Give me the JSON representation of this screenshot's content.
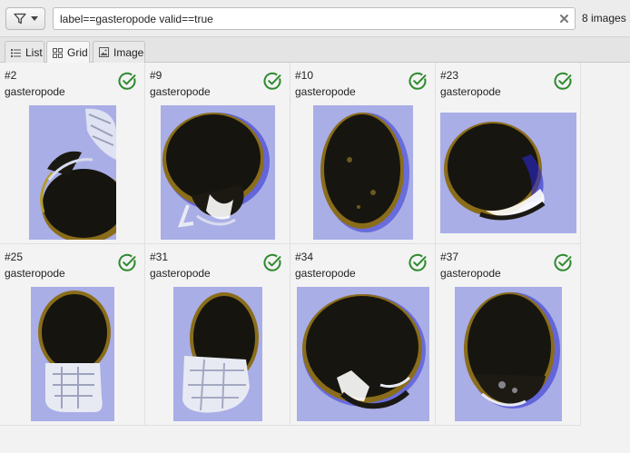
{
  "toolbar": {
    "filter_icon": "filter-icon",
    "search_value": "label==gasteropode valid==true",
    "image_count": "8 images"
  },
  "tabs": [
    {
      "label": "List",
      "icon": "list-icon"
    },
    {
      "label": "Grid",
      "icon": "grid-icon",
      "active": true
    },
    {
      "label": "Image",
      "icon": "image-icon"
    }
  ],
  "colors": {
    "valid_check": "#2f8a2f",
    "thumb_background": "#a9aee6"
  },
  "items": [
    {
      "id": "#2",
      "label": "gasteropode",
      "valid": true
    },
    {
      "id": "#9",
      "label": "gasteropode",
      "valid": true
    },
    {
      "id": "#10",
      "label": "gasteropode",
      "valid": true
    },
    {
      "id": "#23",
      "label": "gasteropode",
      "valid": true
    },
    {
      "id": "#25",
      "label": "gasteropode",
      "valid": true
    },
    {
      "id": "#31",
      "label": "gasteropode",
      "valid": true
    },
    {
      "id": "#34",
      "label": "gasteropode",
      "valid": true
    },
    {
      "id": "#37",
      "label": "gasteropode",
      "valid": true
    }
  ]
}
